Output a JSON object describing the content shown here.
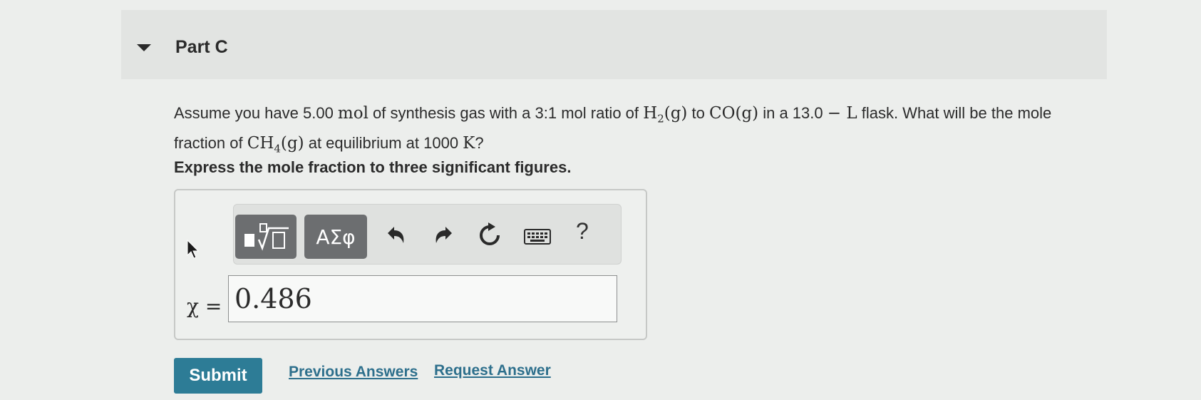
{
  "part": {
    "title": "Part C"
  },
  "question": {
    "text_1": "Assume you have 5.00 ",
    "unit_mol": "mol",
    "text_2": " of synthesis gas with a 3:1 mol ratio of ",
    "h2": "H",
    "h2_sub": "2",
    "h2_phase": "(g)",
    "text_3": " to ",
    "co": "CO(g)",
    "text_4": " in a 13.0 ",
    "unit_l": "− L",
    "text_5": " flask. What will be the mole fraction of ",
    "ch4": "CH",
    "ch4_sub": "4",
    "ch4_phase": "(g)",
    "text_6": " at equilibrium at 1000 ",
    "unit_k": "K",
    "text_7": "?"
  },
  "instruction": "Express the mole fraction to three significant figures.",
  "toolbar": {
    "templates_icon": "fraction-radical-template-icon",
    "greek_label": "ΑΣφ",
    "undo_icon": "undo-icon",
    "redo_icon": "redo-icon",
    "reset_icon": "reset-icon",
    "keyboard_icon": "keyboard-icon",
    "help_label": "?"
  },
  "answer": {
    "variable_label": "χ =",
    "value": "0.486"
  },
  "actions": {
    "submit_label": "Submit",
    "previous_answers_label": "Previous Answers",
    "request_answer_label": "Request Answer"
  },
  "colors": {
    "submit_bg": "#2d7c96",
    "link": "#2d6f8c",
    "toolbar_button": "#6c6e70"
  }
}
